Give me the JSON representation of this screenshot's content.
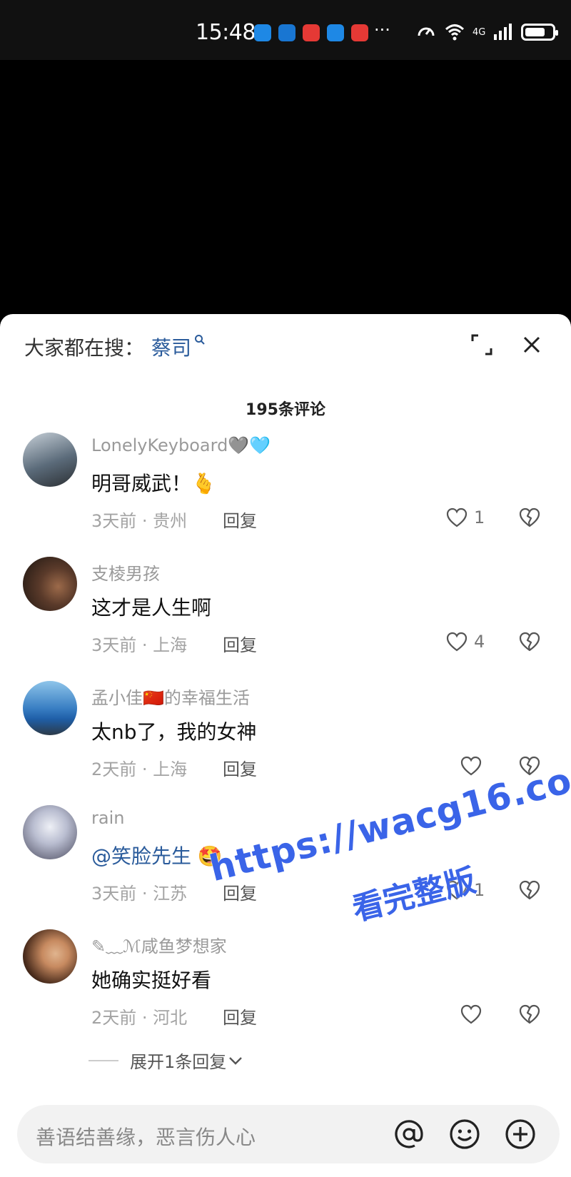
{
  "status_bar": {
    "time": "15:48",
    "network": "4G",
    "battery_level": 0.75,
    "app_icon_colors": [
      "#1e88e5",
      "#1976d2",
      "#e53935",
      "#1e88e5",
      "#e53935"
    ]
  },
  "sheet": {
    "search_prefix": "大家都在搜：",
    "search_term": "蔡司",
    "comment_count": "195条评论"
  },
  "comments": [
    {
      "username": "LonelyKeyboard🩶🩵",
      "text": "明哥威武！🫰",
      "meta": "3天前 · 贵州",
      "reply": "回复",
      "likes": "1",
      "avatar_colors": [
        "#5b6b7a",
        "#c7d0d8"
      ]
    },
    {
      "username": "支棱男孩",
      "text": "这才是人生啊",
      "meta": "3天前 · 上海",
      "reply": "回复",
      "likes": "4",
      "avatar_colors": [
        "#3a2a22",
        "#9c6a4a"
      ]
    },
    {
      "username": "孟小佳🇨🇳的幸福生活",
      "text": "太nb了，我的女神",
      "meta": "2天前 · 上海",
      "reply": "回复",
      "likes": "",
      "avatar_colors": [
        "#1f5fa8",
        "#8ec5ea"
      ]
    },
    {
      "username": "rain",
      "text": "@笑脸先生 🤩",
      "meta": "3天前 · 江苏",
      "reply": "回复",
      "likes": "1",
      "avatar_colors": [
        "#4a4a5e",
        "#d9dbe6"
      ]
    },
    {
      "username": "✎﹏ℳ咸鱼梦想家",
      "text": "她确实挺好看",
      "meta": "2天前 · 河北",
      "reply": "回复",
      "likes": "",
      "avatar_colors": [
        "#2a1a12",
        "#c78a60"
      ]
    }
  ],
  "expand_replies": "展开1条回复",
  "input": {
    "placeholder": "善语结善缘，恶言伤人心"
  },
  "watermark": {
    "line1": "https://wacg16.com",
    "line2": "看完整版"
  },
  "colors": {
    "accent": "#2a5b9b",
    "watermark": "#3a64e8"
  }
}
